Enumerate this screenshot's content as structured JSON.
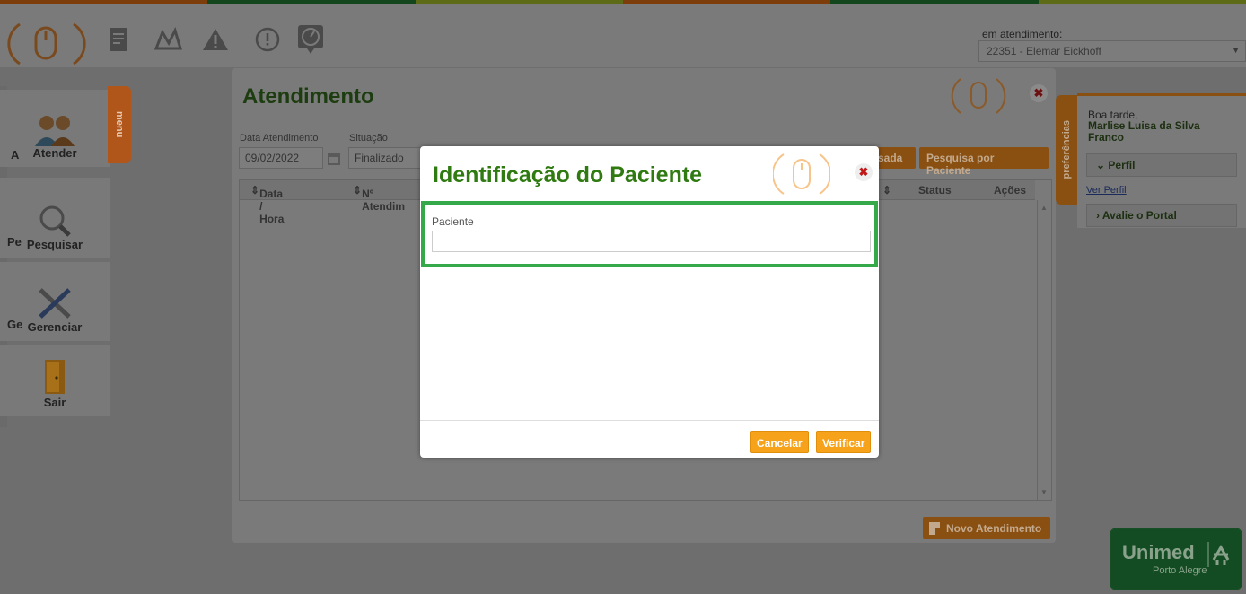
{
  "topbar": {
    "attendance_label": "em atendimento:",
    "attendance_value": "22351 - Elemar Eickhoff",
    "icons": [
      "mouse-logo-icon",
      "document-icon",
      "chart-icon",
      "warning-icon",
      "alert-icon",
      "clock-icon"
    ]
  },
  "menu": {
    "tab_label": "menu",
    "items": [
      {
        "label": "Atender",
        "icon": "users-icon",
        "cut": "A"
      },
      {
        "label": "Pesquisar",
        "icon": "search-icon",
        "cut": "Pe"
      },
      {
        "label": "Gerenciar",
        "icon": "tools-icon",
        "cut": "Ge"
      },
      {
        "label": "Sair",
        "icon": "door-icon",
        "cut": ""
      }
    ]
  },
  "main": {
    "title": "Atendimento",
    "date_label": "Data Atendimento",
    "date_value": "09/02/2022",
    "status_label": "Situação",
    "status_value": "Finalizado",
    "btn_partial": "sada",
    "btn_search_patient": "Pesquisa por Paciente",
    "columns": [
      "Data / Hora",
      "Nº Atendim",
      "Status",
      "Ações"
    ],
    "btn_new": "Novo Atendimento"
  },
  "right_panel": {
    "tab_label": "preferências",
    "greeting": "Boa tarde,",
    "user_name": "Marlise Luisa da Silva Franco",
    "profile_btn": "Perfil",
    "view_profile_link": "Ver Perfil",
    "rate_btn": "Avalie o Portal"
  },
  "modal": {
    "title": "Identificação do Paciente",
    "field_label": "Paciente",
    "field_value": "",
    "cancel": "Cancelar",
    "verify": "Verificar"
  },
  "logo": {
    "name": "Unimed",
    "sub": "Porto Alegre"
  },
  "colors": {
    "accent_orange": "#f7a21b",
    "title_green": "#2f7a11",
    "highlight_green": "#35a84a",
    "brand_green": "#134c22"
  }
}
